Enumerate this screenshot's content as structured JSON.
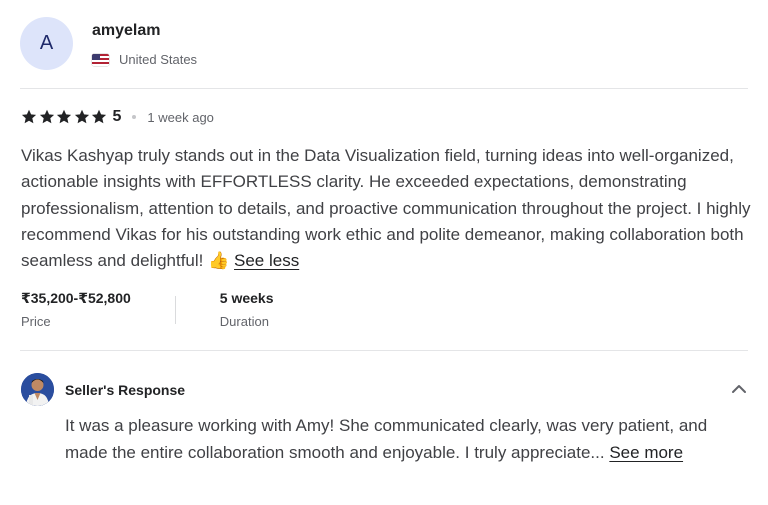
{
  "reviewer": {
    "initial": "A",
    "username": "amyelam",
    "country": "United States",
    "flag_icon": "us-flag-icon"
  },
  "rating": {
    "stars": 5,
    "value": "5",
    "time_ago": "1 week ago",
    "star_color": "#222325"
  },
  "review": {
    "text": "Vikas Kashyap truly stands out in the Data Visualization field, turning ideas into well-organized, actionable insights with EFFORTLESS clarity. He exceeded expectations, demonstrating professionalism, attention to details, and proactive communication throughout the project. I highly recommend Vikas for his outstanding work ethic and polite demeanor, making collaboration both seamless and delightful! ",
    "emoji": "👍",
    "see_less_label": "See less"
  },
  "meta": {
    "price_value": "₹35,200-₹52,800",
    "price_label": "Price",
    "duration_value": "5 weeks",
    "duration_label": "Duration"
  },
  "seller_response": {
    "title": "Seller's Response",
    "text": "It was a pleasure working with Amy! She communicated clearly, was very patient, and made the entire collaboration smooth and enjoyable. I truly appreciate...",
    "see_more_label": "See more",
    "chevron_icon": "chevron-up-icon"
  },
  "colors": {
    "avatar_bg": "#dde4fa",
    "divider": "#e4e5e7",
    "text_primary": "#222325",
    "text_secondary": "#62646a"
  }
}
